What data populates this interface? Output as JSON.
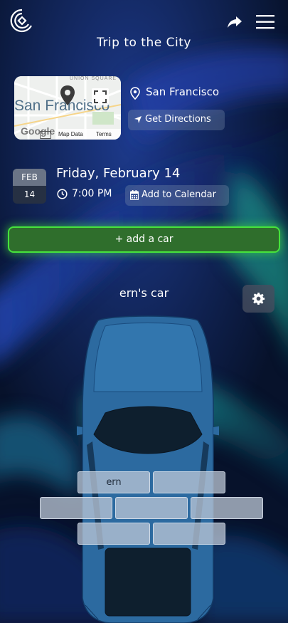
{
  "header": {
    "logo_icon": "c-logo-icon",
    "share_icon": "share-arrow-icon",
    "menu_icon": "hamburger-menu-icon",
    "title": "Trip to the City"
  },
  "location": {
    "map_place_label": "San Francisco",
    "map_street_label": "UNION SQUARE",
    "map_attribution": "Google",
    "map_data_label": "Map Data",
    "map_terms_label": "Terms",
    "city": "San Francisco",
    "directions_label": "Get Directions"
  },
  "event": {
    "month": "FEB",
    "day": "14",
    "date_long": "Friday, February 14",
    "time": "7:00 PM",
    "calendar_label": "Add to Calendar"
  },
  "actions": {
    "add_car_label": "+ add a car"
  },
  "car": {
    "name": "ern's car",
    "color": "#2c6aa0",
    "seats": [
      "ern",
      "",
      "",
      "",
      "",
      "",
      ""
    ]
  },
  "colors": {
    "accent_green": "#46e33c",
    "background": "#07122b"
  }
}
